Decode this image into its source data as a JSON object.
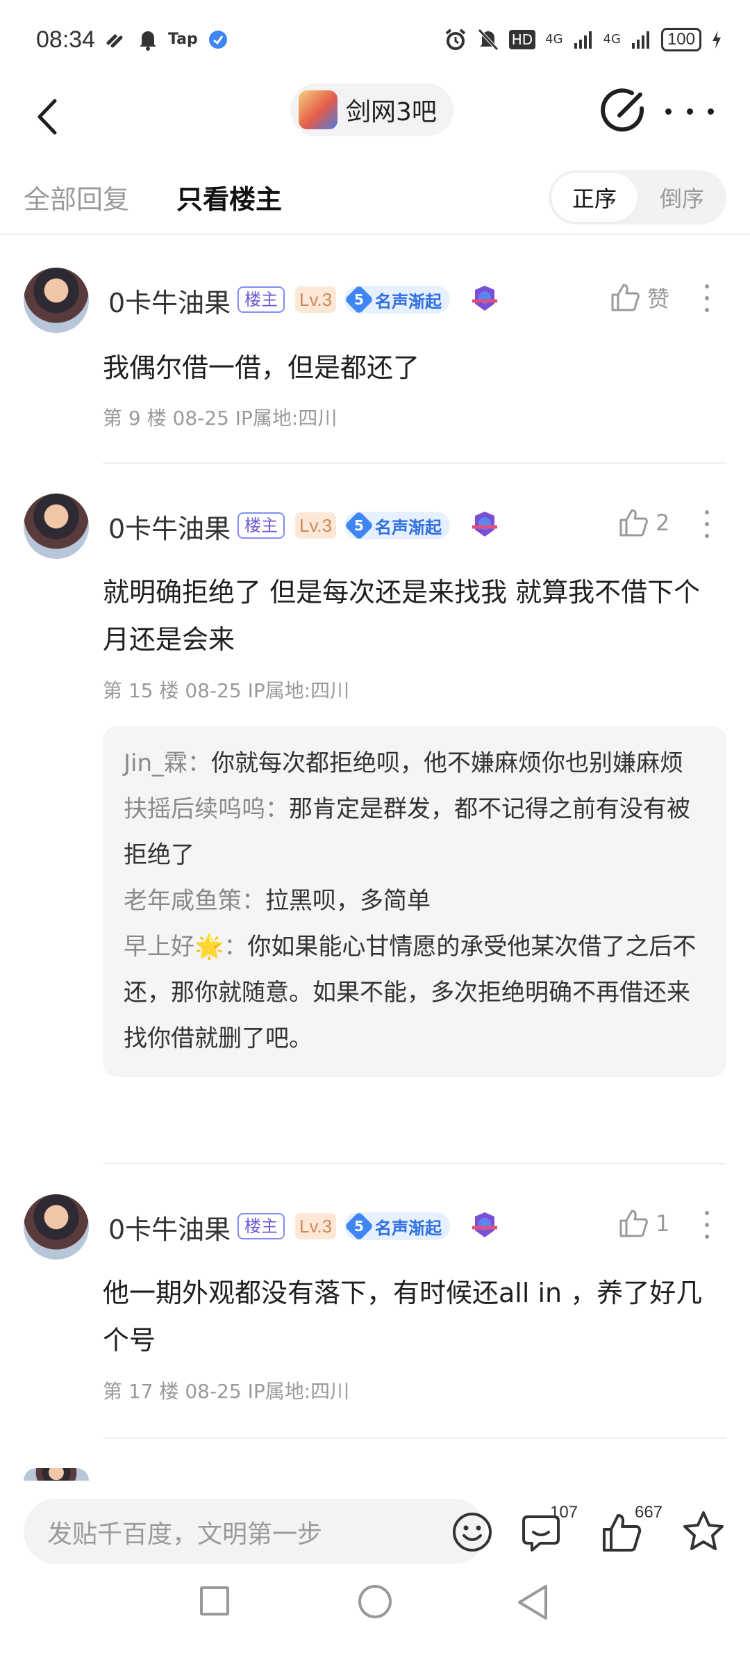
{
  "status_bar": {
    "time": "08:34",
    "tap_label": "Tap",
    "hd_label": "HD",
    "net1": "4G",
    "net2": "4G",
    "battery": "100"
  },
  "header": {
    "forum_name": "剑网3吧",
    "icons": [
      "back-chevron-icon",
      "forum-logo",
      "edit-post-icon",
      "more-dots-icon"
    ]
  },
  "tabs": {
    "all_replies": "全部回复",
    "op_only": "只看楼主",
    "sort_asc": "正序",
    "sort_desc": "倒序"
  },
  "posts": [
    {
      "username": "0卡牛油果",
      "op_badge": "楼主",
      "level": "Lv.3",
      "fame_level": "5",
      "fame_title": "名声渐起",
      "like_label": "赞",
      "content": "我偶尔借一借，但是都还了",
      "meta": "第 9 楼  08-25  IP属地:四川"
    },
    {
      "username": "0卡牛油果",
      "op_badge": "楼主",
      "level": "Lv.3",
      "fame_level": "5",
      "fame_title": "名声渐起",
      "like_label": "2",
      "content": "就明确拒绝了 但是每次还是来找我 就算我不借下个月还是会来",
      "meta": "第 15 楼  08-25  IP属地:四川",
      "replies": [
        {
          "name": "Jin_霖",
          "text": "你就每次都拒绝呗，他不嫌麻烦你也别嫌麻烦"
        },
        {
          "name": "扶摇后续呜呜",
          "text": "那肯定是群发，都不记得之前有没有被拒绝了"
        },
        {
          "name": "老年咸鱼策",
          "text": "拉黑呗，多简单"
        },
        {
          "name": "早上好🌟",
          "text": "你如果能心甘情愿的承受他某次借了之后不还，那你就随意。如果不能，多次拒绝明确不再借还来找你借就删了吧。"
        }
      ]
    },
    {
      "username": "0卡牛油果",
      "op_badge": "楼主",
      "level": "Lv.3",
      "fame_level": "5",
      "fame_title": "名声渐起",
      "like_label": "1",
      "content": "他一期外观都没有落下，有时候还all in ，养了好几个号",
      "meta": "第 17 楼  08-25  IP属地:四川"
    }
  ],
  "reply_separator": "：",
  "bottom_bar": {
    "input_placeholder": "发贴千百度，文明第一步",
    "comment_count": "107",
    "like_count": "667"
  },
  "colors": {
    "accent_blue": "#3f86f5",
    "op_badge": "#6a5bd6",
    "level_badge_bg": "#fde8d8",
    "muted_text": "#9a9a9a"
  }
}
